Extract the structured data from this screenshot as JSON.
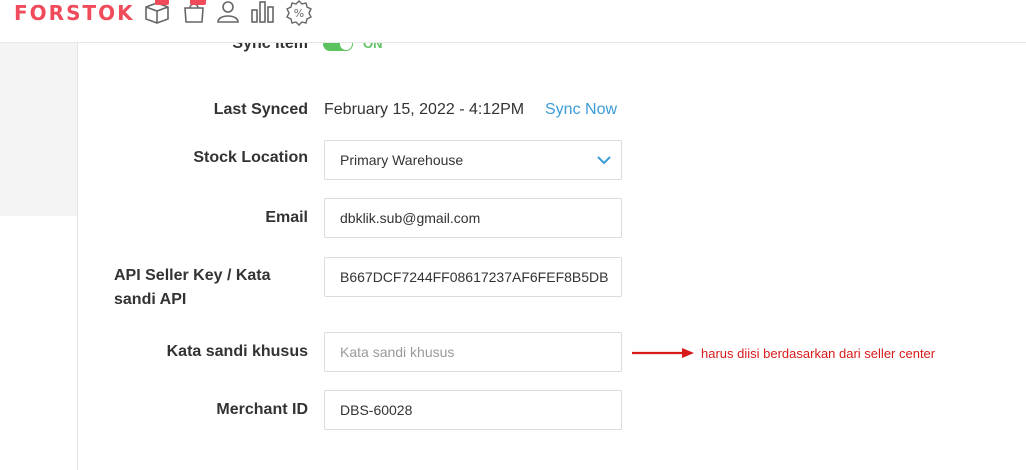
{
  "header": {
    "logo": "FORSTOK",
    "nav_icons": [
      "box-icon",
      "bag-icon",
      "user-icon",
      "bar-chart-icon",
      "percent-icon"
    ],
    "brand_color": "#ef4b5a"
  },
  "form": {
    "sync_item": {
      "label": "Sync Item",
      "state": "ON",
      "enabled": true
    },
    "last_synced": {
      "label": "Last Synced",
      "value": "February 15, 2022 - 4:12PM",
      "action": "Sync Now"
    },
    "stock_location": {
      "label": "Stock Location",
      "value": "Primary Warehouse"
    },
    "email": {
      "label": "Email",
      "value": "dbklik.sub@gmail.com"
    },
    "api_key": {
      "label": "API Seller Key / Kata sandi API",
      "value": "B667DCF7244FF08617237AF6FEF8B5DB"
    },
    "kata_sandi": {
      "label": "Kata sandi khusus",
      "value": "",
      "placeholder": "Kata sandi khusus"
    },
    "merchant_id": {
      "label": "Merchant ID",
      "value": "DBS-60028"
    }
  },
  "annotation": {
    "text": "harus diisi berdasarkan dari seller center",
    "color": "#d71a1a"
  }
}
